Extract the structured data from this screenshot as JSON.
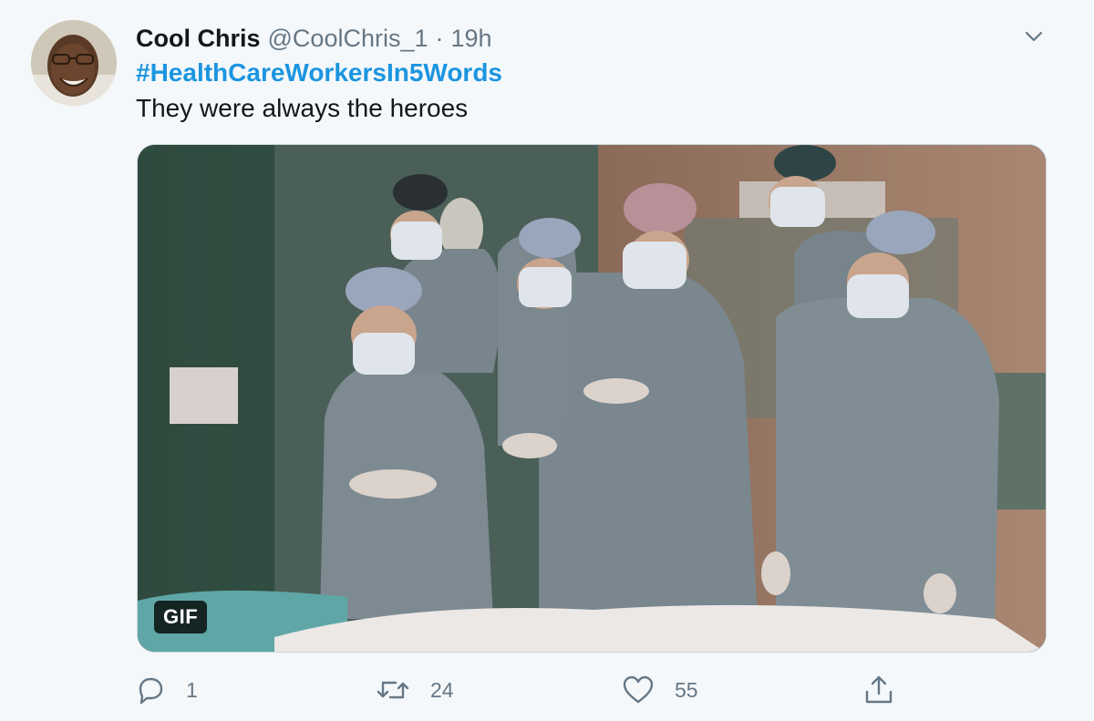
{
  "tweet": {
    "author_name": "Cool Chris",
    "handle": "@CoolChris_1",
    "separator": "·",
    "time": "19h",
    "hashtag": "#HealthCareWorkersIn5Words",
    "text": "They were always the heroes",
    "media_badge": "GIF"
  },
  "actions": {
    "replies": "1",
    "retweets": "24",
    "likes": "55"
  },
  "icons": {
    "reply": "reply-icon",
    "retweet": "retweet-icon",
    "like": "heart-icon",
    "share": "share-icon",
    "menu": "chevron-down-icon"
  },
  "colors": {
    "hashtag": "#1b95e0",
    "secondary_text": "#657786",
    "background": "#f5f8fa"
  }
}
